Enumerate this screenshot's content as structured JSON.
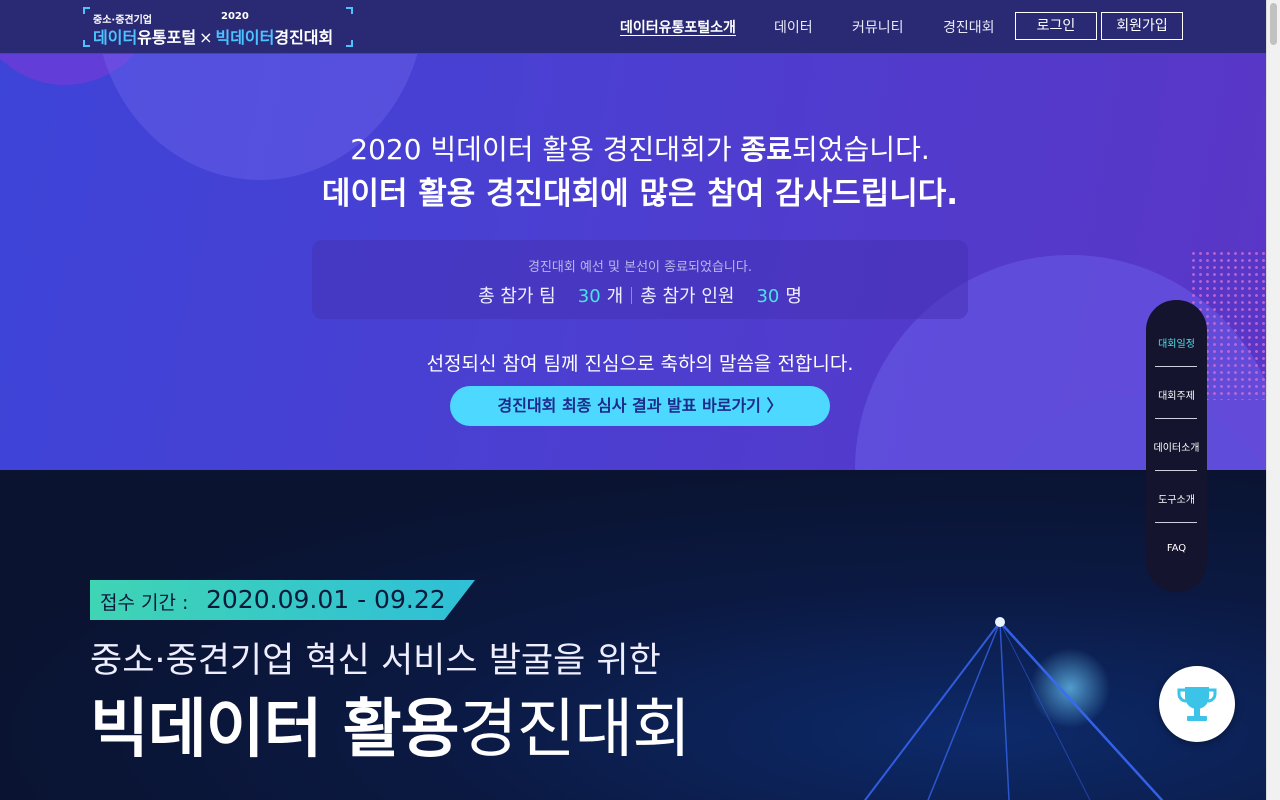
{
  "header": {
    "logo": {
      "small_left": "중소·중견기업",
      "small_right": "2020",
      "part1_accent": "데이터",
      "part1": "유통포털",
      "times": "×",
      "part2_accent": "빅데이터",
      "part2": "경진대회"
    },
    "nav": [
      "데이터유통포털소개",
      "데이터",
      "커뮤니티",
      "경진대회"
    ],
    "login": "로그인",
    "signup": "회원가입"
  },
  "hero": {
    "line1_pre": "2020 빅데이터 활용 경진대회가 ",
    "line1_bold": "종료",
    "line1_post": "되었습니다.",
    "line2": "데이터 활용 경진대회에 많은 참여 감사드립니다.",
    "stats": {
      "note": "경진대회 예선 및 본선이 종료되었습니다.",
      "teams_label": "총 참가 팀",
      "teams_value": "30",
      "teams_unit": "개",
      "people_label": "총 참가 인원",
      "people_value": "30",
      "people_unit": "명"
    },
    "congrats": "선정되신 참여 팀께 진심으로 축하의 말씀을 전합니다.",
    "cta": "경진대회 최종 심사 결과 발표 바로가기 〉"
  },
  "contest": {
    "period_label": "접수 기간 :",
    "period_value": "2020.09.01 - 09.22",
    "subtitle": "중소·중견기업 혁신 서비스 발굴을 위한",
    "title_bold": "빅데이터 활용",
    "title_light": "경진대회"
  },
  "sidenav": [
    "대회일정",
    "대회주제",
    "데이터소개",
    "도구소개",
    "FAQ"
  ],
  "colors": {
    "accent": "#4de0e8",
    "cta": "#4dd9ff",
    "header": "#2a2a74"
  },
  "icons": {
    "floating": "trophy-icon"
  }
}
